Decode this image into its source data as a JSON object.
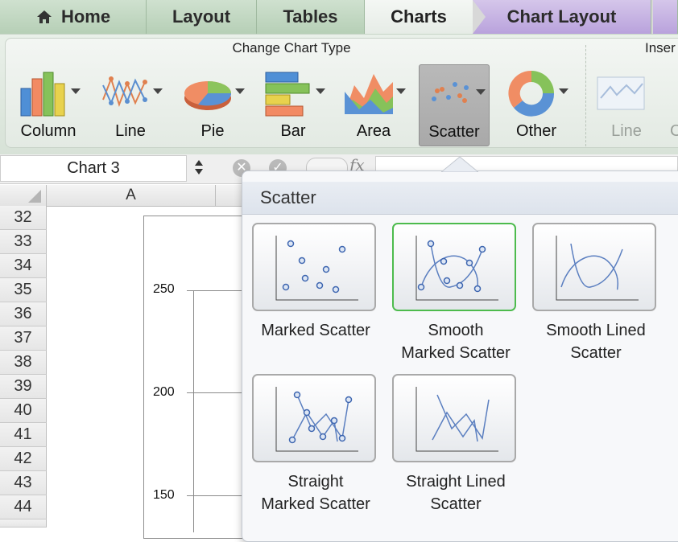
{
  "tabs": {
    "home": "Home",
    "layout": "Layout",
    "tables": "Tables",
    "charts": "Charts",
    "chart_layout": "Chart Layout"
  },
  "ribbon": {
    "group_title": "Change Chart Type",
    "insert_title": "Inser",
    "buttons": {
      "column": "Column",
      "line": "Line",
      "pie": "Pie",
      "bar": "Bar",
      "area": "Area",
      "scatter": "Scatter",
      "other": "Other",
      "sparkline_line": "Line"
    }
  },
  "formula_bar": {
    "name_box": "Chart 3",
    "fx_label": "fx"
  },
  "grid": {
    "column_a": "A",
    "rows": [
      "32",
      "33",
      "34",
      "35",
      "36",
      "37",
      "38",
      "39",
      "40",
      "41",
      "42",
      "43",
      "44"
    ],
    "axis_labels": [
      "250",
      "200",
      "150"
    ]
  },
  "popup": {
    "title": "Scatter",
    "options": [
      {
        "label_line1": "Marked Scatter",
        "label_line2": ""
      },
      {
        "label_line1": "Smooth",
        "label_line2": "Marked Scatter"
      },
      {
        "label_line1": "Smooth Lined",
        "label_line2": "Scatter"
      },
      {
        "label_line1": "Straight",
        "label_line2": "Marked Scatter"
      },
      {
        "label_line1": "Straight Lined",
        "label_line2": "Scatter"
      }
    ]
  },
  "colors": {
    "tab_green": "#b6cfb6",
    "tab_purple": "#b9a2dc",
    "highlight_green": "#4dbb4d",
    "series_blue": "#5b7fc0"
  }
}
